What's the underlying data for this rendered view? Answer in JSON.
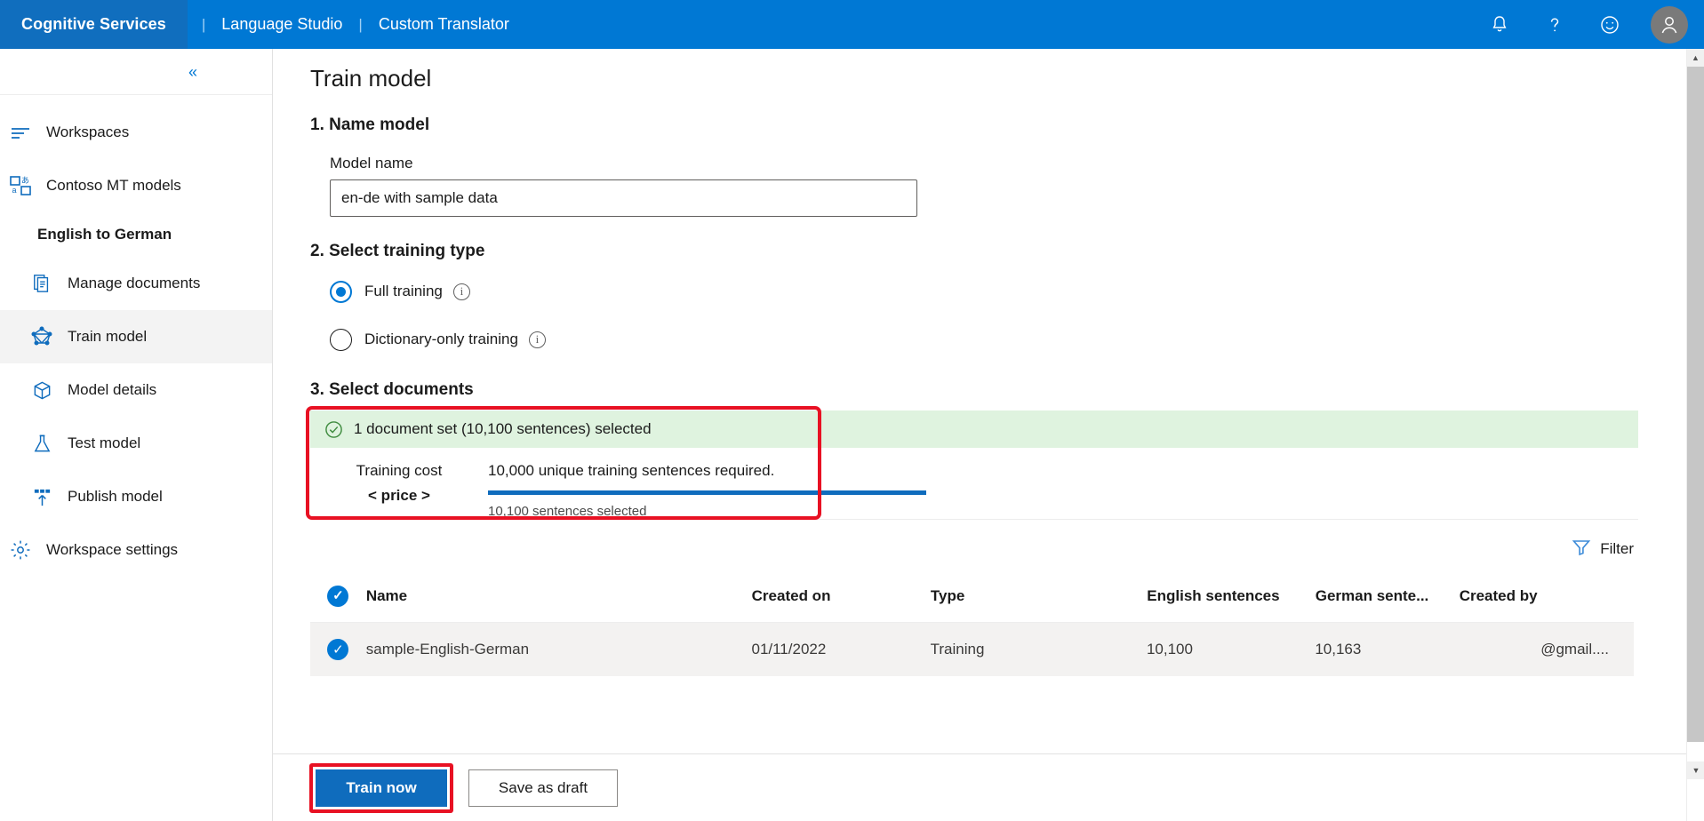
{
  "topbar": {
    "brand": "Cognitive Services",
    "separator": "|",
    "links": [
      "Language Studio",
      "Custom Translator"
    ],
    "icons": [
      "bell-icon",
      "help-icon",
      "feedback-icon",
      "account-avatar"
    ],
    "background": "#0078d4",
    "brand_background": "#106ebe"
  },
  "sidebar": {
    "collapse_label": "«",
    "items": [
      {
        "label": "Workspaces",
        "icon": "workspaces-icon",
        "active": false,
        "indent": false
      },
      {
        "label": "Contoso MT models",
        "icon": "translate-models-icon",
        "active": false,
        "indent": false
      }
    ],
    "project_heading": "English to German",
    "sub_items": [
      {
        "label": "Manage documents",
        "icon": "documents-icon",
        "active": false
      },
      {
        "label": "Train model",
        "icon": "train-model-icon",
        "active": true
      },
      {
        "label": "Model details",
        "icon": "package-icon",
        "active": false
      },
      {
        "label": "Test model",
        "icon": "flask-icon",
        "active": false
      },
      {
        "label": "Publish model",
        "icon": "publish-icon",
        "active": false
      }
    ],
    "settings_item": {
      "label": "Workspace settings",
      "icon": "gear-icon"
    }
  },
  "main": {
    "page_title": "Train model",
    "step1": {
      "title": "1. Name model",
      "field_label": "Model name",
      "input_value": "en-de with sample data",
      "input_placeholder": "Model name"
    },
    "step2": {
      "title": "2. Select training type",
      "options": [
        {
          "label": "Full training",
          "selected": true,
          "info": "i"
        },
        {
          "label": "Dictionary-only training",
          "selected": false,
          "info": "i"
        }
      ]
    },
    "step3": {
      "title": "3. Select documents",
      "summary_banner": "1 document set (10,100 sentences) selected",
      "cost_label": "Training cost",
      "cost_value": "< price >",
      "requirement_text": "10,000 unique training sentences required.",
      "selected_text": "10,100 sentences selected",
      "progress_percent": 100,
      "banner_color": "#dff3df",
      "meter_color": "#0f6cbd",
      "highlight_color": "#e81123"
    },
    "filter": {
      "label": "Filter",
      "icon": "filter-icon"
    },
    "table": {
      "columns": [
        "Name",
        "Created on",
        "Type",
        "English sentences",
        "German sente...",
        "Created by"
      ],
      "select_all_checked": true,
      "rows": [
        {
          "selected": true,
          "name": "sample-English-German",
          "created_on": "01/11/2022",
          "type": "Training",
          "english_sentences": "10,100",
          "german_sentences": "10,163",
          "created_by": "@gmail...."
        }
      ]
    }
  },
  "footer": {
    "primary_button": "Train now",
    "secondary_button": "Save as draft"
  },
  "scrollbar": {
    "up": "▲",
    "down": "▼"
  }
}
